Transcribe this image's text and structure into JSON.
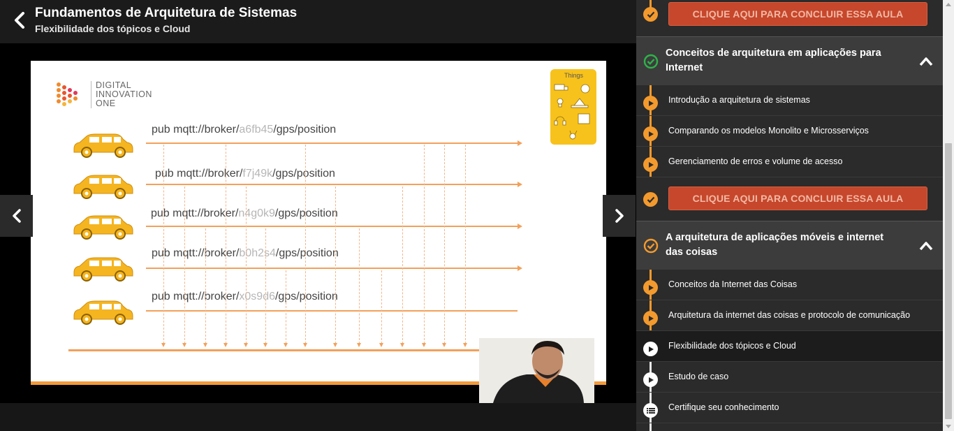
{
  "header": {
    "course_title": "Fundamentos de Arquitetura de Sistemas",
    "lesson_title": "Flexibilidade dos tópicos e Cloud"
  },
  "slide": {
    "logo_lines": [
      "DIGITAL",
      "INNOVATION",
      "ONE"
    ],
    "things_label": "Things",
    "topics": [
      {
        "prefix": "pub mqtt://broker/",
        "id": "a6fb45",
        "suffix": "/gps/position"
      },
      {
        "prefix": "pub mqtt://broker/",
        "id": "f7j49k",
        "suffix": "/gps/position"
      },
      {
        "prefix": "pub mqtt://broker/",
        "id": "n4g0k9",
        "suffix": "/gps/position"
      },
      {
        "prefix": "pub mqtt://broker/",
        "id": "b0h2s4",
        "suffix": "/gps/position"
      },
      {
        "prefix": "pub mqtt://broker/",
        "id": "x0s9d6",
        "suffix": "/gps/position"
      }
    ]
  },
  "sidebar": {
    "conclude_label": "CLIQUE AQUI PARA CONCLUIR ESSA AULA",
    "modules": [
      {
        "title": "Conceitos de arquitetura em aplicações para Internet",
        "status": "complete",
        "lessons": [
          "Introdução a arquitetura de sistemas",
          "Comparando os modelos Monolito e Microsserviços",
          "Gerenciamento de erros e volume de acesso"
        ]
      },
      {
        "title": "A arquitetura de aplicações móveis e internet das coisas",
        "status": "in-progress",
        "lessons": [
          "Conceitos da Internet das Coisas",
          "Arquitetura da internet das coisas e protocolo de comunicação",
          "Flexibilidade dos tópicos e Cloud",
          "Estudo de caso",
          "Certifique seu conhecimento"
        ]
      }
    ]
  },
  "colors": {
    "accent_orange": "#f39a2e",
    "conclude_red": "#c6472b",
    "complete_green": "#2fb24a"
  }
}
